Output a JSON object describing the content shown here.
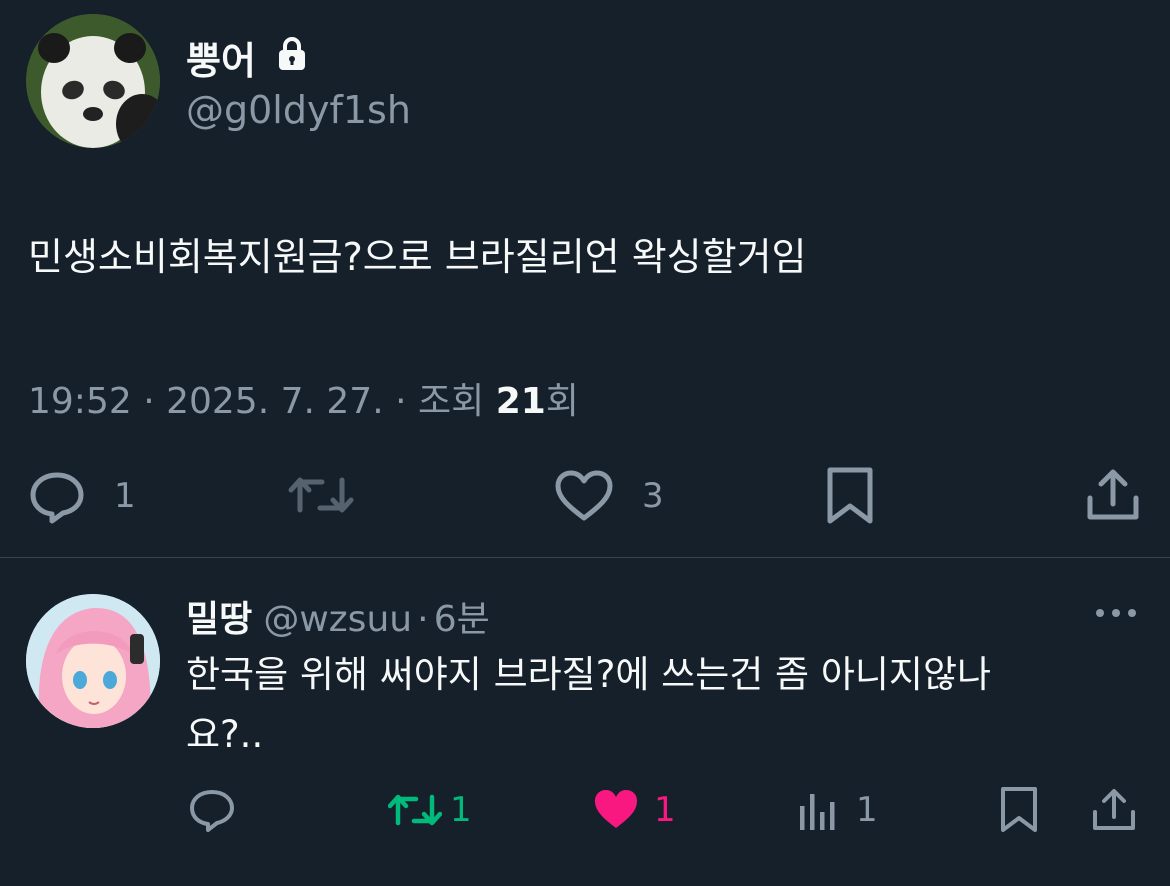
{
  "main_tweet": {
    "display_name": "뿡어",
    "handle": "@g0ldyf1sh",
    "text": "민생소비회복지원금?으로 브라질리언 왁싱할거임",
    "time": "19:52",
    "date": "2025. 7. 27.",
    "views_label": "조회",
    "views_count": "21",
    "views_unit": "회",
    "reply_count": "1",
    "like_count": "3"
  },
  "reply_tweet": {
    "display_name": "밀땅",
    "handle": "@wzsuu",
    "time_ago": "6분",
    "text_line1": "한국을 위해 써야지 브라질?에 쓰는건 좀 아니지않나",
    "text_line2": "요?..",
    "retweet_count": "1",
    "like_count": "1",
    "views_count": "1"
  },
  "colors": {
    "background": "#15202b",
    "text_primary": "#f7f9f9",
    "text_secondary": "#8b98a5",
    "retweet_active": "#00ba7c",
    "like_active": "#f91880",
    "divider": "#38444d"
  },
  "icons": {
    "lock": "lock-icon",
    "reply": "reply-icon",
    "retweet": "retweet-icon",
    "like": "heart-icon",
    "bookmark": "bookmark-icon",
    "share": "share-icon",
    "more": "more-icon",
    "views": "views-icon"
  }
}
